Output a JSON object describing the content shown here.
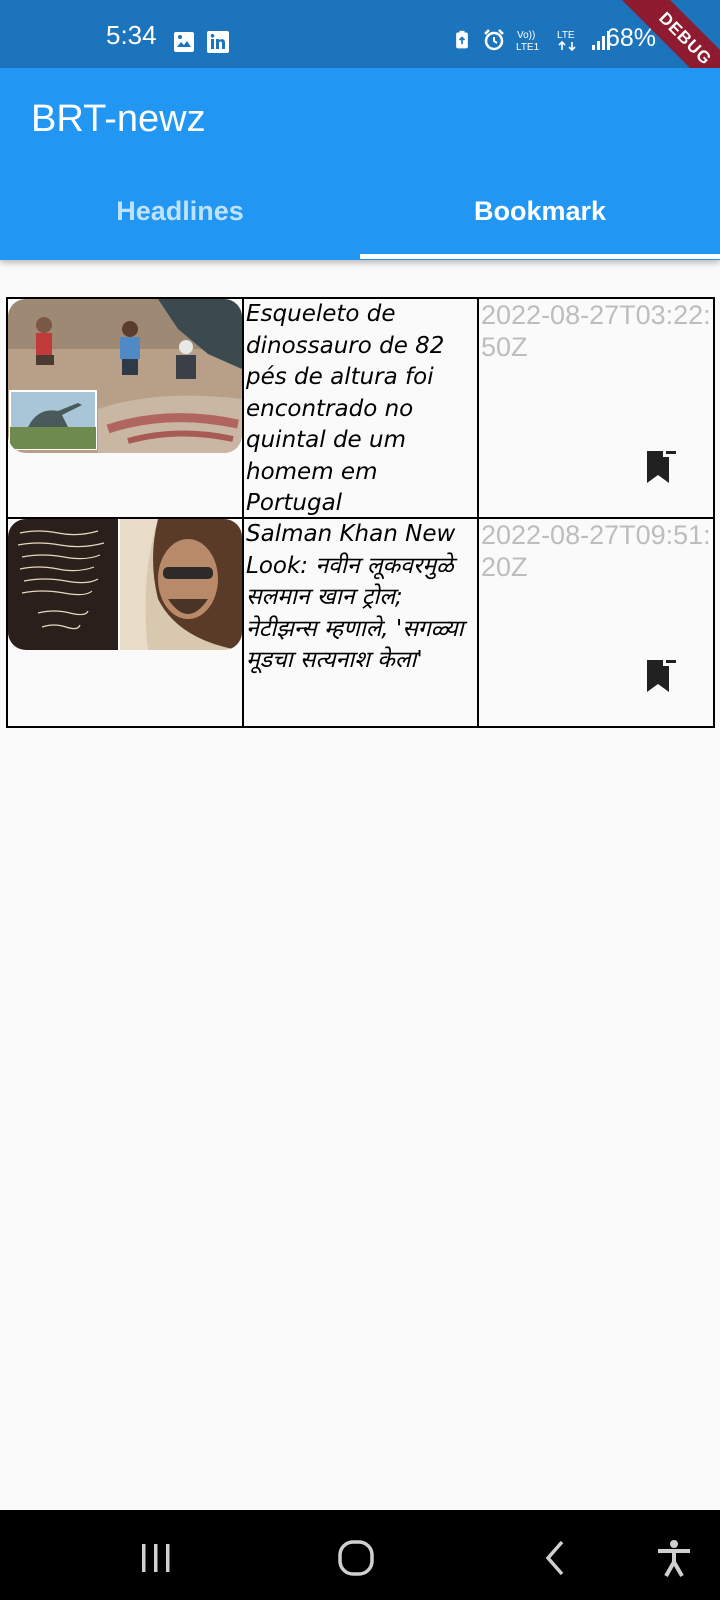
{
  "status_bar": {
    "time": "5:34",
    "battery": "68%",
    "icons": [
      "gallery-icon",
      "linkedin-icon",
      "battery-saver-icon",
      "alarm-icon",
      "volte-icon",
      "lte-icon",
      "signal-icon",
      "battery-icon"
    ],
    "debug_label": "DEBUG"
  },
  "app_bar": {
    "title": "BRT-newz",
    "tabs": [
      {
        "label": "Headlines",
        "selected": false
      },
      {
        "label": "Bookmark",
        "selected": true
      }
    ]
  },
  "bookmarks": [
    {
      "title": "Esqueleto de dinossauro de 82 pés de altura foi encontrado no quintal de um homem em Portugal",
      "date": "2022-08-27T03:22:50Z",
      "thumbnail": "dinosaur-excavation-photo",
      "icon": "bookmark-remove-icon"
    },
    {
      "title": "Salman Khan New Look: नवीन लूकवरमुळे सलमान खान ट्रोल; नेटीझन्स म्हणाले, 'सगळ्या मूडचा सत्यनाश केला'",
      "date": "2022-08-27T09:51:20Z",
      "thumbnail": "salman-khan-photo",
      "icon": "bookmark-remove-icon"
    }
  ],
  "colors": {
    "status_bar": "#1c74bd",
    "app_bar": "#2196f3",
    "tab_selected": "#ffffff",
    "tab_unselected": "#bfe3ff",
    "date_text": "#bdbdbd",
    "debug_ribbon": "#8e1b2f"
  },
  "nav_bar": {
    "buttons": [
      "recent-apps-icon",
      "home-icon",
      "back-icon",
      "accessibility-icon"
    ]
  }
}
